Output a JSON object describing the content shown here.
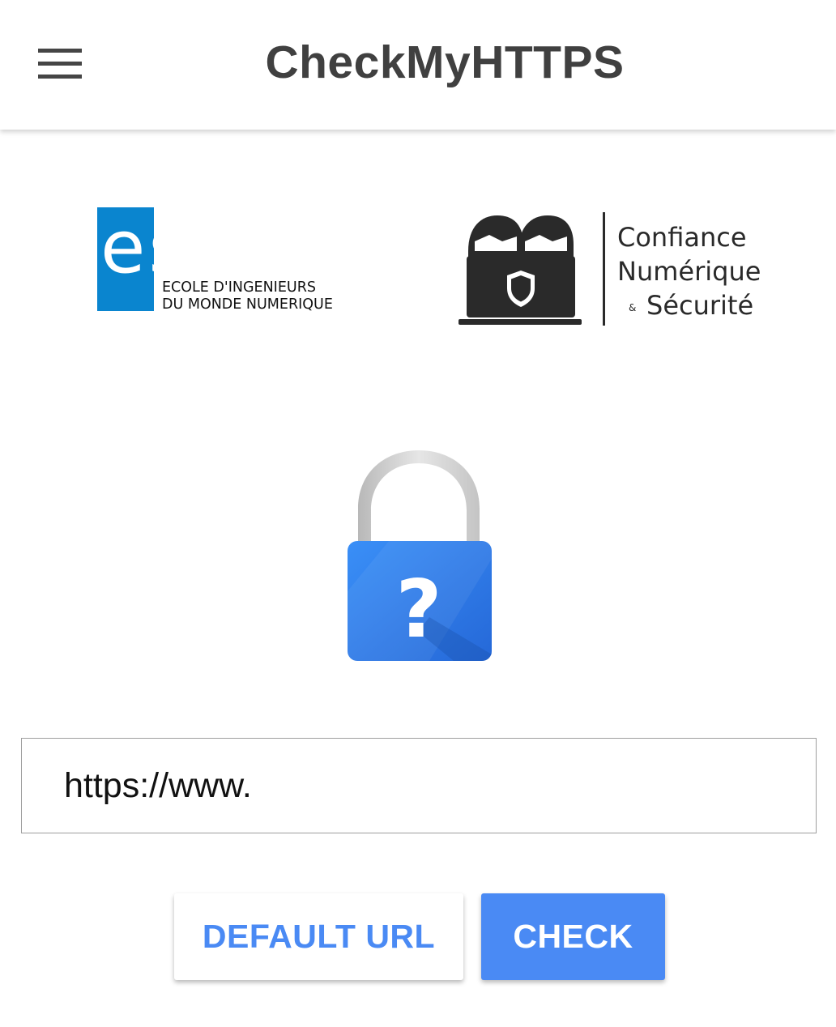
{
  "appbar": {
    "title": "CheckMyHTTPS",
    "menu_icon": "hamburger-menu-icon"
  },
  "logos": {
    "esiea": {
      "word": "esiea",
      "line1": "ECOLE D'INGENIEURS",
      "line2": "DU MONDE NUMERIQUE",
      "brand_color": "#0a85cf"
    },
    "cns": {
      "line1": "Confiance",
      "line2": "Numérique",
      "line3_amp": "&",
      "line3": "Sécurité"
    }
  },
  "status": {
    "icon": "lock-unknown-icon",
    "symbol": "?",
    "lock_color": "#2f80ed"
  },
  "url_input": {
    "value": "https://www."
  },
  "buttons": {
    "default_url": "DEFAULT URL",
    "check": "CHECK"
  },
  "colors": {
    "accent": "#4a8af4",
    "title_text": "#404040"
  }
}
